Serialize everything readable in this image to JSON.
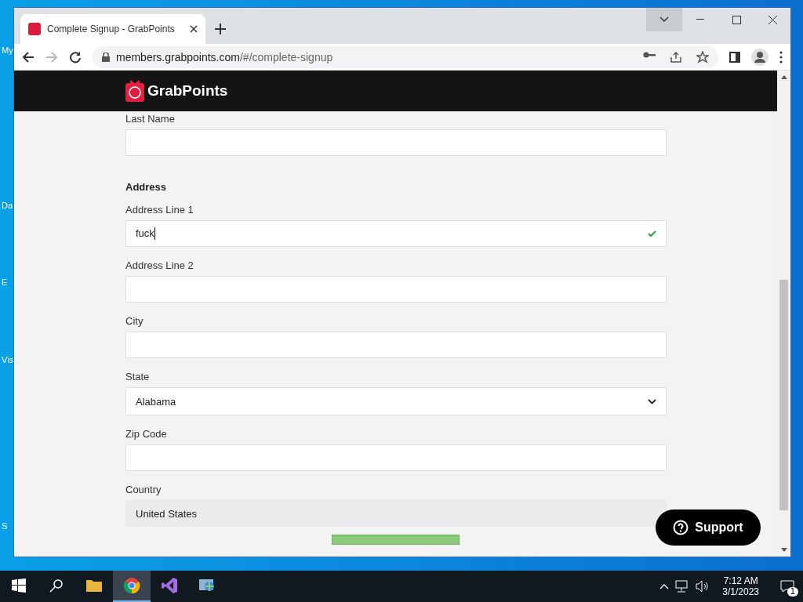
{
  "desktop": {
    "icon_labels": [
      "My",
      "Da",
      "E",
      "Vis",
      "S"
    ]
  },
  "browser": {
    "tabs": [
      {
        "title": "Complete Signup - GrabPoints",
        "selected": true
      }
    ],
    "url_host": "members.grabpoints.com",
    "url_path": "/#/complete-signup"
  },
  "site": {
    "logo": "GrabPoints"
  },
  "form": {
    "items": [
      {
        "kind": "input",
        "label": "Last Name",
        "value": "",
        "valid": false,
        "disabled": false
      },
      {
        "kind": "heading",
        "label": "Address"
      },
      {
        "kind": "input",
        "label": "Address Line 1",
        "value": "fuck",
        "valid": true,
        "disabled": false
      },
      {
        "kind": "input",
        "label": "Address Line 2",
        "value": "",
        "valid": false,
        "disabled": false
      },
      {
        "kind": "input",
        "label": "City",
        "value": "",
        "valid": false,
        "disabled": false
      },
      {
        "kind": "select",
        "label": "State",
        "value": "Alabama"
      },
      {
        "kind": "input",
        "label": "Zip Code",
        "value": "",
        "valid": false,
        "disabled": false
      },
      {
        "kind": "input",
        "label": "Country",
        "value": "United States",
        "valid": false,
        "disabled": true
      }
    ]
  },
  "support": {
    "label": "Support"
  },
  "taskbar": {
    "apps": [
      {
        "kind": "folder",
        "selected": false
      },
      {
        "kind": "chrome",
        "selected": true
      },
      {
        "kind": "vs",
        "selected": false
      },
      {
        "kind": "network",
        "selected": false
      }
    ],
    "time": "7:12 AM",
    "date": "3/1/2023",
    "notifications": "1"
  }
}
